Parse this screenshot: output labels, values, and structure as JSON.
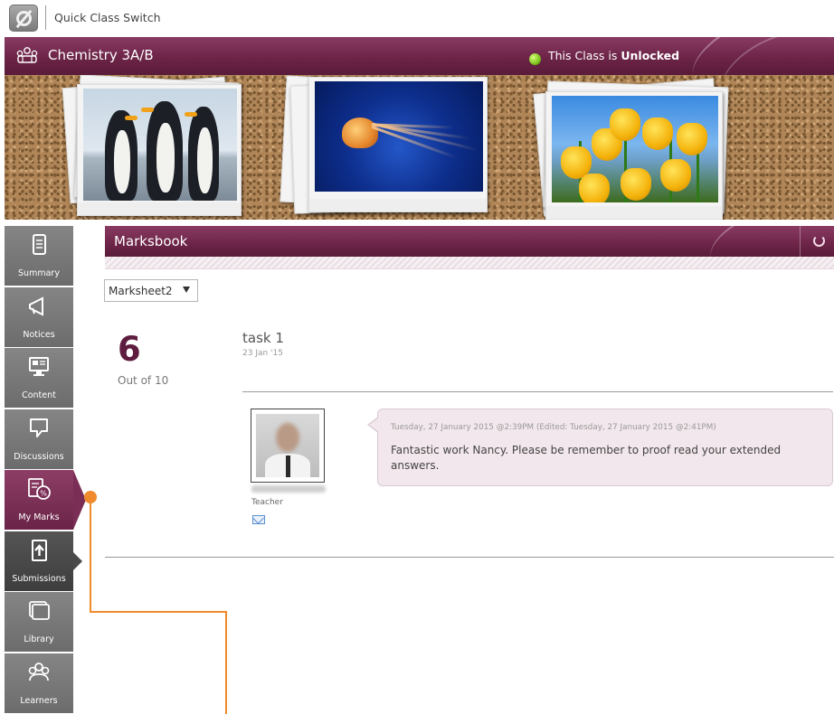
{
  "topbar": {
    "switcher_label": "Quick Class Switch",
    "app_icon": "app-logo-icon"
  },
  "class_header": {
    "class_name": "Chemistry 3A/B",
    "class_icon": "class-group-icon",
    "status_prefix": "This Class is",
    "status_value": "Unlocked",
    "status_color": "#7cc21c",
    "accent_color": "#6c2447"
  },
  "banner": {
    "photos": [
      "penguins",
      "jellyfish",
      "tulips"
    ]
  },
  "sidebar": {
    "items": [
      {
        "label": "Summary",
        "icon": "summary-icon"
      },
      {
        "label": "Notices",
        "icon": "megaphone-icon"
      },
      {
        "label": "Content",
        "icon": "monitor-icon"
      },
      {
        "label": "Discussions",
        "icon": "speech-bubble-icon"
      },
      {
        "label": "My Marks",
        "icon": "marks-icon",
        "active": true
      },
      {
        "label": "Submissions",
        "icon": "upload-icon"
      },
      {
        "label": "Library",
        "icon": "library-icon"
      },
      {
        "label": "Learners",
        "icon": "people-icon"
      }
    ]
  },
  "marksbook": {
    "title": "Marksbook",
    "refresh_icon": "refresh-icon",
    "marksheet_select": {
      "selected": "Marksheet2"
    },
    "score": "6",
    "out_of": "Out of 10",
    "task": {
      "title": "task 1",
      "date": "23 Jan '15"
    },
    "comment": {
      "author_role": "Teacher",
      "mail_icon": "mail-icon",
      "meta": "Tuesday, 27 January 2015 @2:39PM (Edited: Tuesday, 27 January 2015 @2:41PM)",
      "text": "Fantastic work Nancy. Please be remember to proof read your extended answers."
    }
  }
}
